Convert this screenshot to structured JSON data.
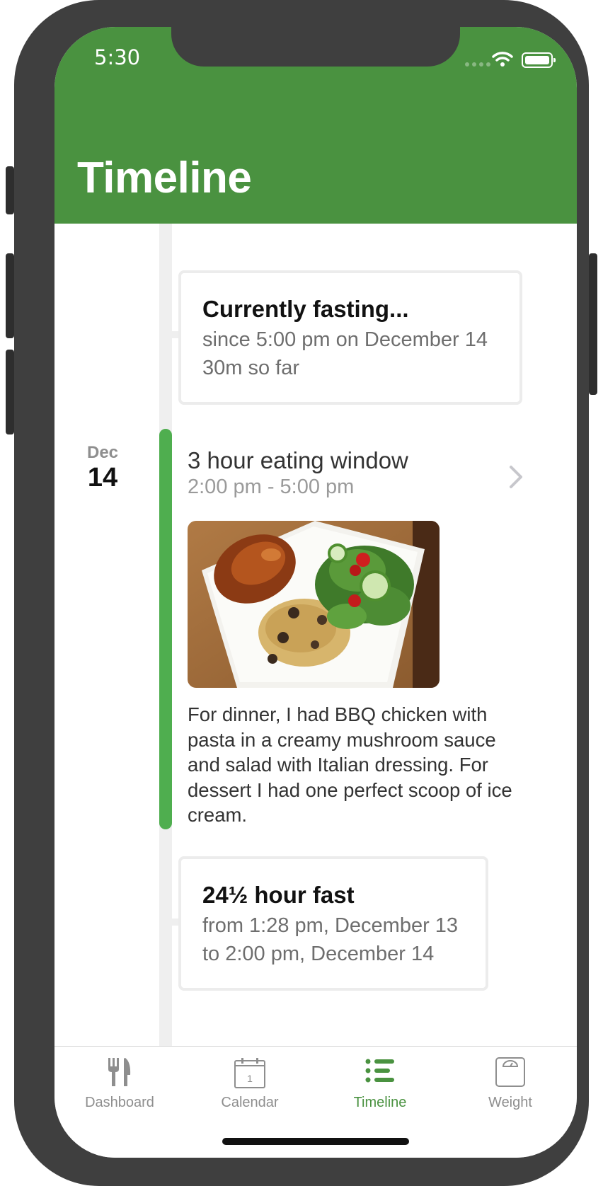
{
  "status_bar": {
    "time": "5:30"
  },
  "header": {
    "title": "Timeline"
  },
  "cards": {
    "current": {
      "title": "Currently fasting...",
      "line1": "since 5:00 pm on December 14",
      "line2": "30m so far"
    },
    "fast": {
      "title": "24½ hour fast",
      "line1": "from 1:28 pm, December 13",
      "line2": "to 2:00 pm, December 14"
    }
  },
  "date": {
    "month": "Dec",
    "day": "14"
  },
  "eating_window": {
    "title": "3 hour eating window",
    "time_range": "2:00 pm - 5:00 pm",
    "note": "For dinner, I had BBQ chicken with pasta in a creamy mushroom sauce and salad with Italian dressing. For dessert I had one perfect scoop of ice cream."
  },
  "colors": {
    "brand_green": "#4a9240",
    "timeline_green": "#4fae4f"
  },
  "tabs": [
    {
      "label": "Dashboard",
      "icon": "fork-knife-icon",
      "active": false
    },
    {
      "label": "Calendar",
      "icon": "calendar-icon",
      "calendar_day": "1",
      "active": false
    },
    {
      "label": "Timeline",
      "icon": "list-icon",
      "active": true
    },
    {
      "label": "Weight",
      "icon": "scale-icon",
      "active": false
    }
  ]
}
